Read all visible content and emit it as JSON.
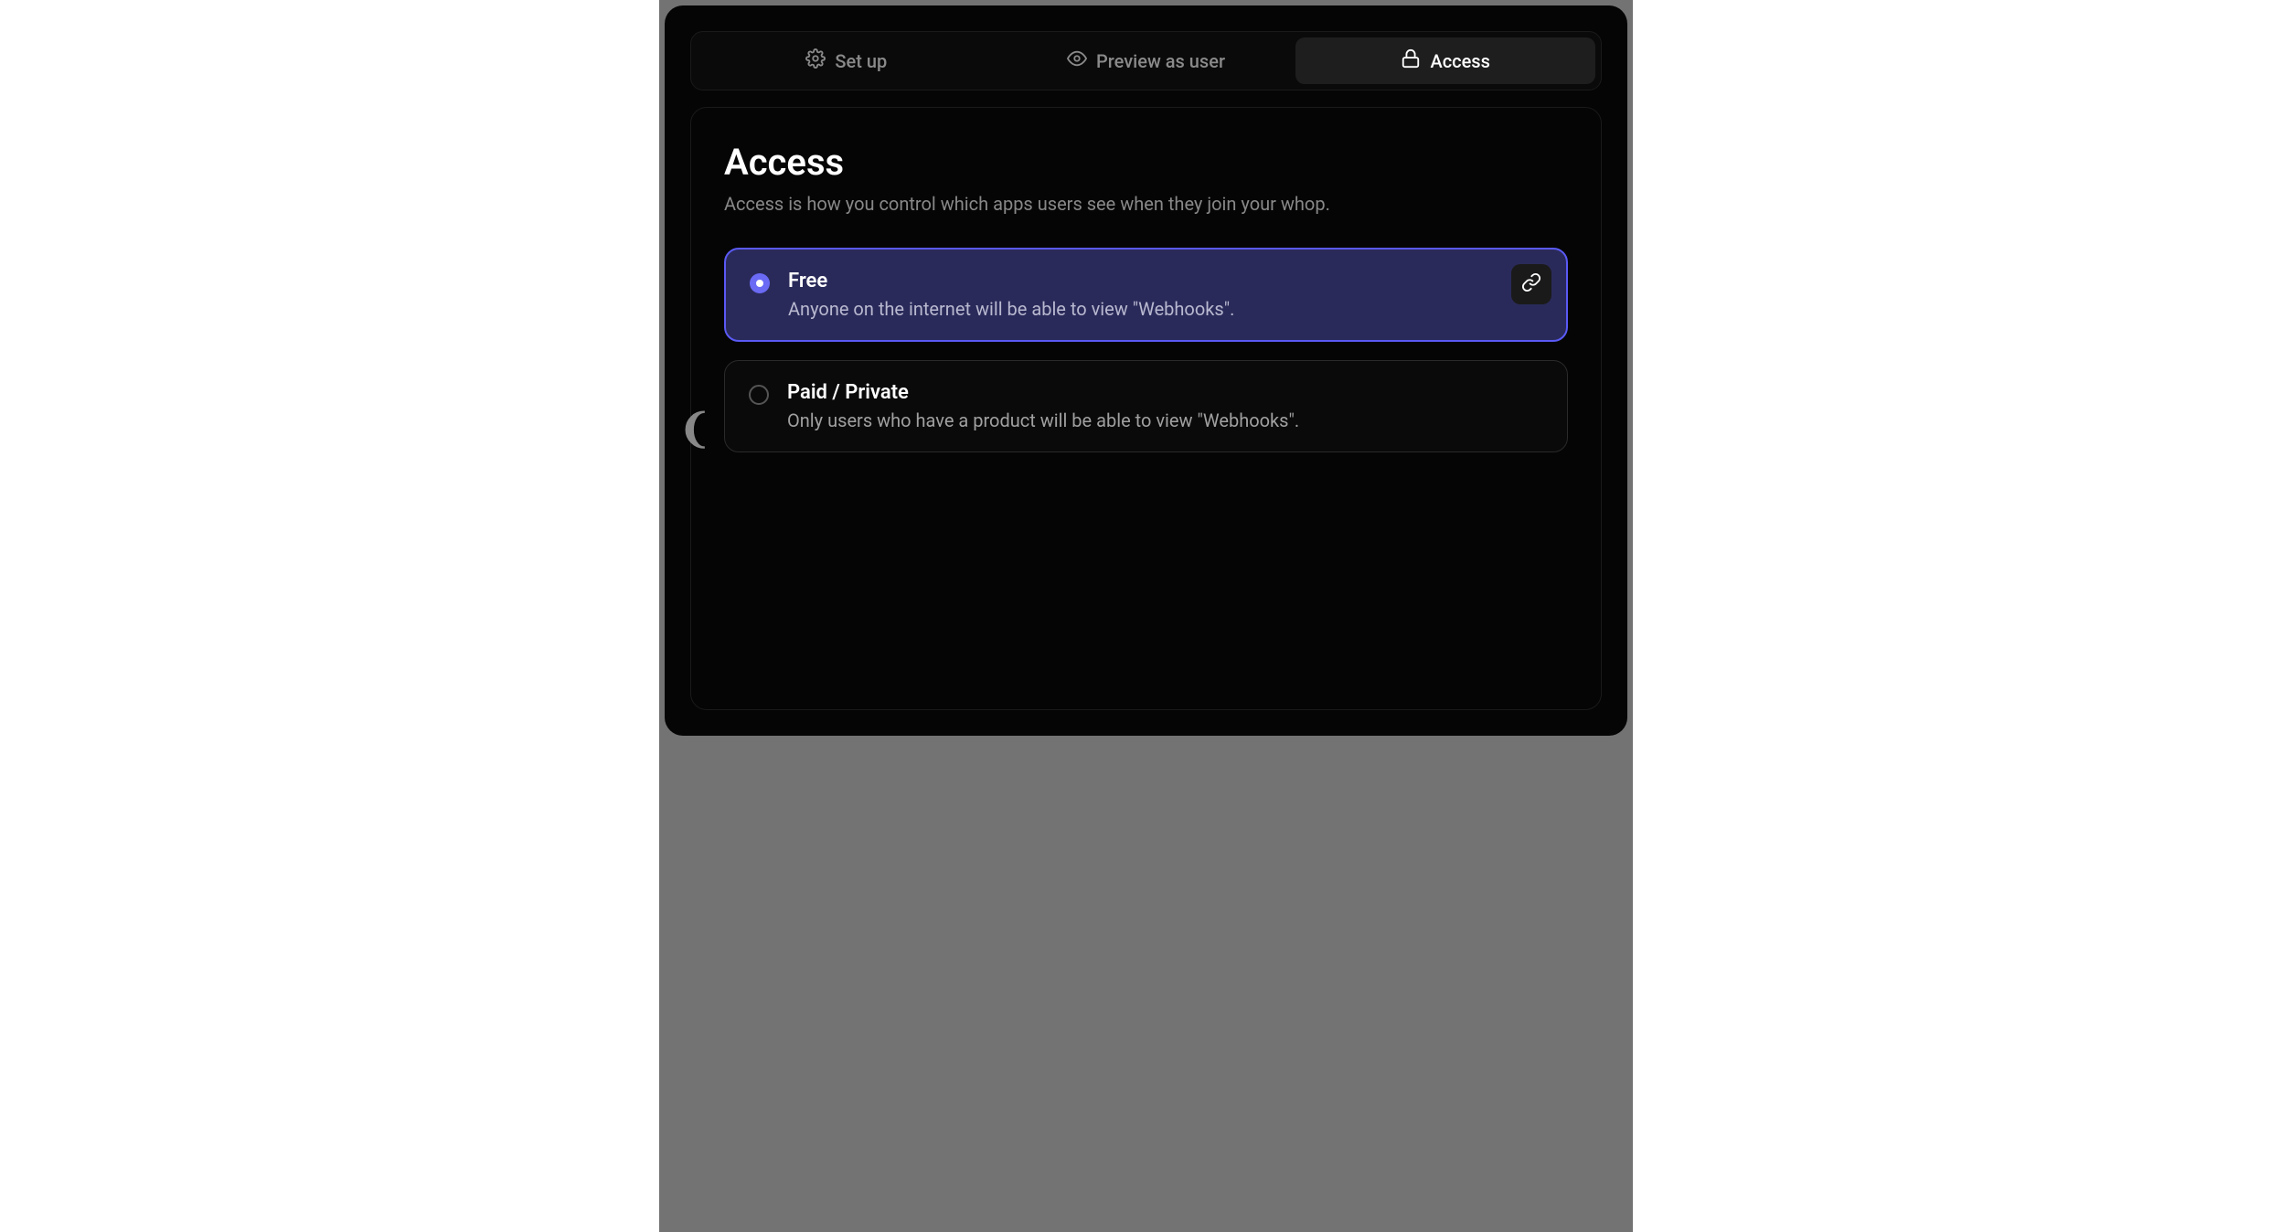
{
  "tabs": {
    "setup": {
      "label": "Set up"
    },
    "preview": {
      "label": "Preview as user"
    },
    "access": {
      "label": "Access"
    }
  },
  "page": {
    "title": "Access",
    "subtitle": "Access is how you control which apps users see when they join your whop."
  },
  "options": {
    "free": {
      "title": "Free",
      "description": "Anyone on the internet will be able to view \"Webhooks\"."
    },
    "paid": {
      "title": "Paid / Private",
      "description": "Only users who have a product will be able to view \"Webhooks\"."
    }
  }
}
